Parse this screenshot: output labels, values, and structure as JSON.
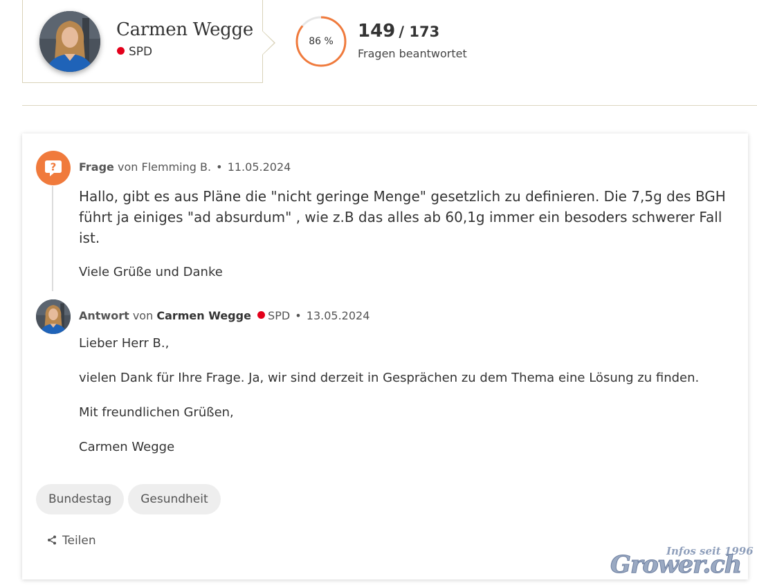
{
  "politician": {
    "name": "Carmen Wegge",
    "party": "SPD",
    "party_color": "#e3001b"
  },
  "stats": {
    "percent_label": "86 %",
    "answered_fraction": 0.86,
    "answered": "149",
    "total": "/ 173",
    "label": "Fragen beantwortet",
    "ring_color": "#f07a3c",
    "ring_track_color": "#e6e6e6"
  },
  "question": {
    "type_label": "Frage",
    "by_label": "von",
    "author": "Flemming B.",
    "bullet": "•",
    "date": "11.05.2024",
    "paragraphs": [
      "Hallo, gibt es aus Pläne die \"nicht geringe Menge\" gesetzlich zu definieren. Die 7,5g des BGH führt ja einiges \"ad absurdum\" , wie z.B das alles ab 60,1g immer ein besoders schwerer Fall ist.",
      "Viele Grüße und Danke"
    ],
    "icon": "question-bubble-icon",
    "icon_color": "#f07a3c"
  },
  "answer": {
    "type_label": "Antwort",
    "by_label": "von",
    "author": "Carmen Wegge",
    "party": "SPD",
    "bullet": "•",
    "date": "13.05.2024",
    "paragraphs": [
      "Lieber Herr B.,",
      "vielen Dank für Ihre Frage. Ja, wir sind derzeit in Gesprächen zu dem Thema eine Lösung zu finden.",
      "Mit freundlichen Grüßen,",
      "Carmen Wegge"
    ]
  },
  "tags": [
    "Bundestag",
    "Gesundheit"
  ],
  "share": {
    "label": "Teilen",
    "icon": "share-icon"
  },
  "watermark": {
    "main": "Grower.ch",
    "small": "Infos seit 1996"
  }
}
